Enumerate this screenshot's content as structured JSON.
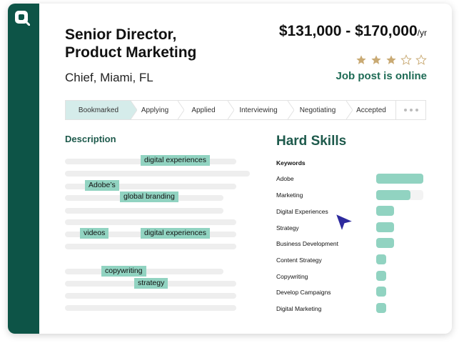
{
  "job": {
    "title_line1": "Senior Director,",
    "title_line2": "Product Marketing",
    "location": "Chief, Miami, FL",
    "salary": "$131,000 - $170,000",
    "salary_unit": "/yr",
    "rating": 3,
    "rating_max": 5,
    "status": "Job post is online"
  },
  "pipeline": {
    "steps": [
      "Bookmarked",
      "Applying",
      "Applied",
      "Interviewing",
      "Negotiating",
      "Accepted"
    ],
    "active": "Bookmarked",
    "more": "•••"
  },
  "description": {
    "heading": "Description",
    "tags": [
      "digital experiences",
      "Adobe’s",
      "global branding",
      "videos",
      "digital experiences",
      "copywriting",
      "strategy"
    ]
  },
  "hard_skills": {
    "heading": "Hard Skills",
    "keywords_label": "Keywords",
    "items": [
      {
        "name": "Adobe",
        "level": 1.0
      },
      {
        "name": "Marketing",
        "level": 0.73
      },
      {
        "name": "Digital Experiences",
        "level": 0.38
      },
      {
        "name": "Strategy",
        "level": 0.38
      },
      {
        "name": "Business Development",
        "level": 0.38
      },
      {
        "name": "Content Strategy",
        "level": 0.21
      },
      {
        "name": "Copywriting",
        "level": 0.21
      },
      {
        "name": "Develop Campaigns",
        "level": 0.21
      },
      {
        "name": "Digital Marketing",
        "level": 0.21
      }
    ]
  },
  "colors": {
    "rail": "#0d5447",
    "accent": "#1e6b55",
    "tag": "#91d3c1",
    "active_step": "#d5ecea",
    "star": "#c9aa74",
    "cursor": "#2d2a9e"
  },
  "icons": [
    "app-logo-icon",
    "star-icon",
    "cursor-icon"
  ]
}
